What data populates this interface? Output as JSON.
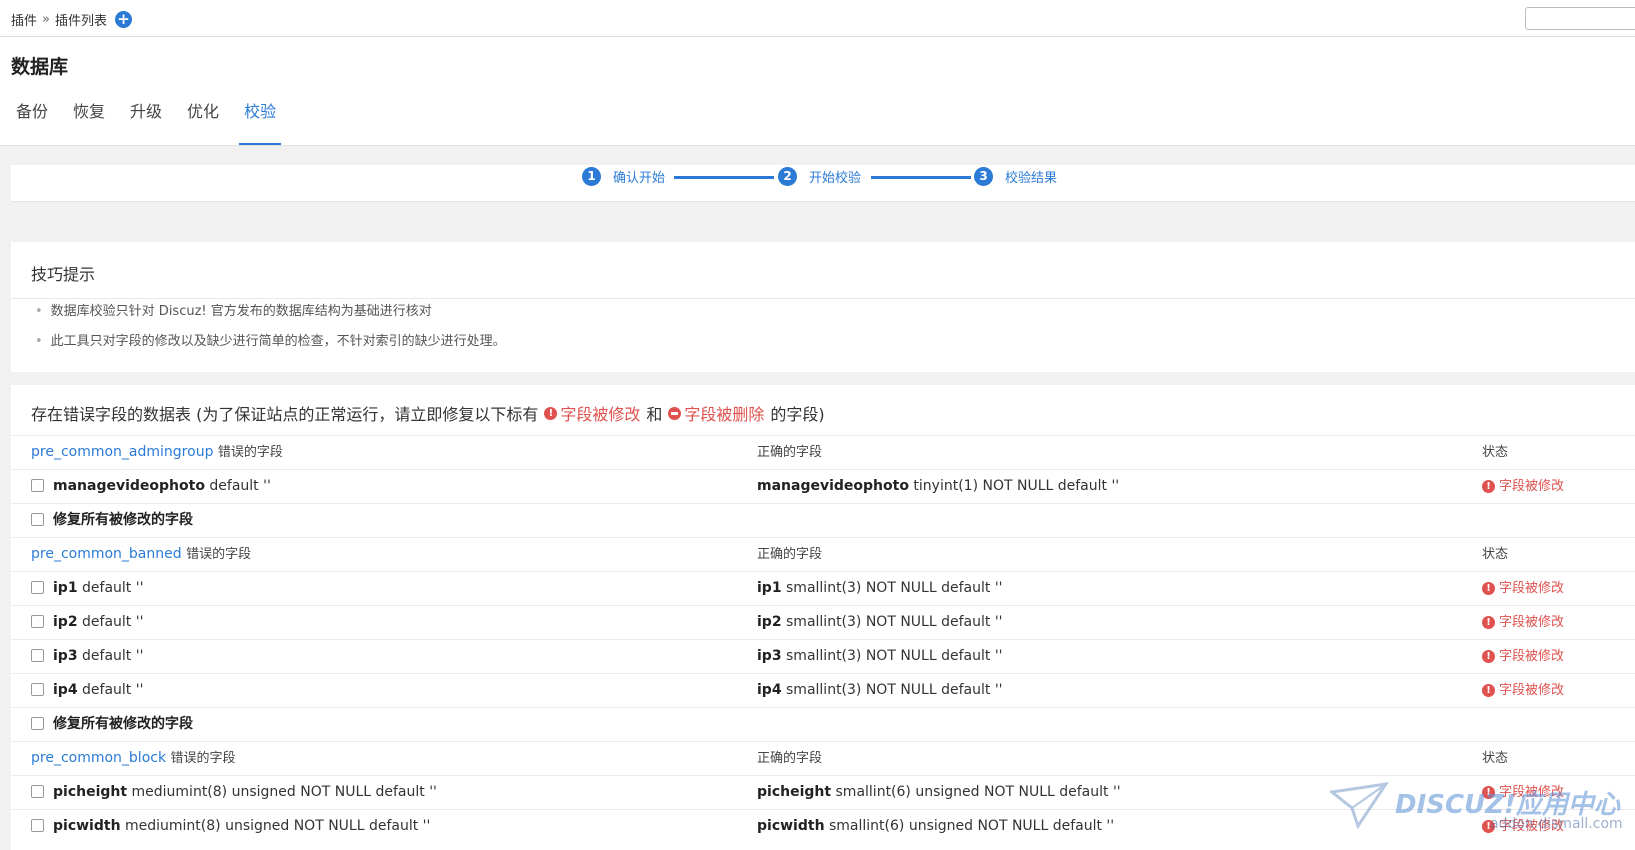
{
  "topbar": {
    "crumb_root": "插件",
    "crumb_sep": "»",
    "crumb_current": "插件列表",
    "add_icon": "+"
  },
  "header": {
    "title": "数据库",
    "tabs": [
      "备份",
      "恢复",
      "升级",
      "优化",
      "校验"
    ],
    "active_tab": "校验"
  },
  "steps": [
    {
      "num": "1",
      "label": "确认开始"
    },
    {
      "num": "2",
      "label": "开始校验"
    },
    {
      "num": "3",
      "label": "校验结果"
    }
  ],
  "tips": {
    "title": "技巧提示",
    "items": [
      "数据库校验只针对 Discuz! 官方发布的数据库结构为基础进行核对",
      "此工具只对字段的修改以及缺少进行简单的检查，不针对索引的缺少进行处理。"
    ]
  },
  "panel": {
    "title_prefix": "存在错误字段的数据表 (为了保证站点的正常运行，请立即修复以下标有",
    "modified_label": "字段被修改",
    "and_text": "和",
    "deleted_label": "字段被删除",
    "title_suffix": "的字段)",
    "wrong_fields_label": "错误的字段",
    "correct_fields_label": "正确的字段",
    "status_label": "状态",
    "fix_all_label": "修复所有被修改的字段",
    "modified_icon": "!",
    "tables": [
      {
        "name": "pre_common_admingroup",
        "fields": [
          {
            "name": "managevideophoto",
            "wrong": "default ''",
            "correct": "tinyint(1) NOT NULL default ''",
            "status": "字段被修改"
          }
        ]
      },
      {
        "name": "pre_common_banned",
        "fields": [
          {
            "name": "ip1",
            "wrong": "default ''",
            "correct": "smallint(3) NOT NULL default ''",
            "status": "字段被修改"
          },
          {
            "name": "ip2",
            "wrong": "default ''",
            "correct": "smallint(3) NOT NULL default ''",
            "status": "字段被修改"
          },
          {
            "name": "ip3",
            "wrong": "default ''",
            "correct": "smallint(3) NOT NULL default ''",
            "status": "字段被修改"
          },
          {
            "name": "ip4",
            "wrong": "default ''",
            "correct": "smallint(3) NOT NULL default ''",
            "status": "字段被修改"
          }
        ]
      },
      {
        "name": "pre_common_block",
        "fields": [
          {
            "name": "picheight",
            "wrong": "mediumint(8) unsigned NOT NULL default ''",
            "correct": "smallint(6) unsigned NOT NULL default ''",
            "status": "字段被修改"
          },
          {
            "name": "picwidth",
            "wrong": "mediumint(8) unsigned NOT NULL default ''",
            "correct": "smallint(6) unsigned NOT NULL default ''",
            "status": "字段被修改"
          }
        ]
      }
    ]
  },
  "watermark": {
    "brand": "DISCUZ!应用中心",
    "url": "addon.dismall.com"
  },
  "colors": {
    "accent": "#2b7bd6",
    "error": "#e0524f"
  }
}
